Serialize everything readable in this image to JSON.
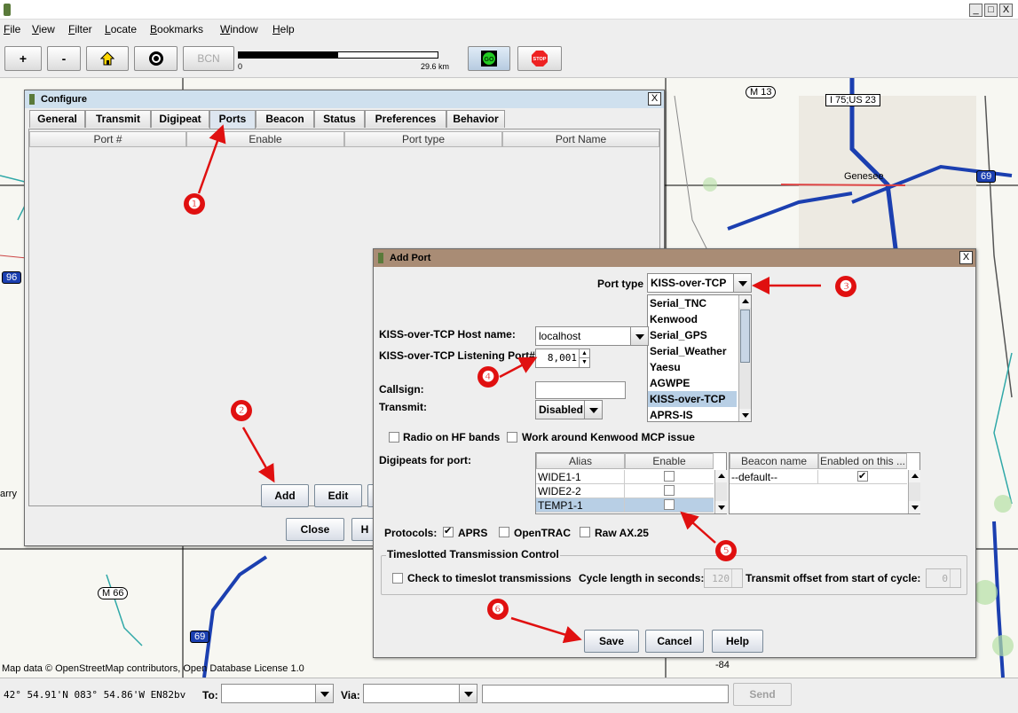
{
  "window": {
    "minimize": "_",
    "maximize": "□",
    "close": "X"
  },
  "menu": [
    {
      "label": "File",
      "u": "F",
      "rest": "ile"
    },
    {
      "label": "View",
      "u": "V",
      "rest": "iew"
    },
    {
      "label": "Filter",
      "u": "F",
      "rest": "ilter"
    },
    {
      "label": "Locate",
      "u": "L",
      "rest": "ocate"
    },
    {
      "label": "Bookmarks",
      "u": "B",
      "rest": "ookmarks"
    },
    {
      "label": "Window",
      "u": "W",
      "rest": "indow"
    },
    {
      "label": "Help",
      "u": "H",
      "rest": "elp"
    }
  ],
  "toolbar": {
    "zoom_in": "+",
    "zoom_out": "-",
    "bcn": "BCN",
    "scale_zero": "0",
    "scale_dist": "29.6 km",
    "scale_fraction": 0.5,
    "go": "GO",
    "stop": "STOP"
  },
  "map": {
    "credit": "Map data © OpenStreetMap contributors, Open Database License 1.0",
    "labels": {
      "m13": "M 13",
      "i75": "I 75;US 23",
      "genesee": "Genesee",
      "i69_east": "69",
      "i96": "96",
      "m66": "M 66",
      "i69_south": "69",
      "harry": "arry",
      "minus84": "-84"
    }
  },
  "configure": {
    "title": "Configure",
    "close": "X",
    "tabs": [
      "General",
      "Transmit",
      "Digipeat",
      "Ports",
      "Beacon",
      "Status",
      "Preferences",
      "Behavior"
    ],
    "active_tab": "Ports",
    "columns": [
      "Port #",
      "Enable",
      "Port type",
      "Port Name"
    ],
    "buttons": {
      "add": "Add",
      "edit": "Edit",
      "close": "Close",
      "help": "H"
    }
  },
  "add_port": {
    "title": "Add Port",
    "close": "X",
    "port_type_label": "Port type",
    "port_type_value": "KISS-over-TCP",
    "port_type_options": [
      "Serial_TNC",
      "Kenwood",
      "Serial_GPS",
      "Serial_Weather",
      "Yaesu",
      "AGWPE",
      "KISS-over-TCP",
      "APRS-IS"
    ],
    "port_type_selected": "KISS-over-TCP",
    "host_label": "KISS-over-TCP Host name:",
    "host_value": "localhost",
    "port_label": "KISS-over-TCP Listening Port#:",
    "port_value": "8,001",
    "callsign_label": "Callsign:",
    "callsign_value": "",
    "transmit_label": "Transmit:",
    "transmit_value": "Disabled",
    "radio_hf": "Radio on HF bands",
    "kenwood_mcp": "Work around Kenwood MCP issue",
    "digipeats_label": "Digipeats for port:",
    "alias_columns": [
      "Alias",
      "Enable"
    ],
    "aliases": [
      {
        "alias": "WIDE1-1",
        "enabled": false
      },
      {
        "alias": "WIDE2-2",
        "enabled": false
      },
      {
        "alias": "TEMP1-1",
        "enabled": false
      }
    ],
    "beacon_columns": [
      "Beacon name",
      "Enabled on this ..."
    ],
    "beacons": [
      {
        "name": "--default--",
        "enabled": true
      }
    ],
    "protocols_label": "Protocols:",
    "protocols": [
      {
        "name": "APRS",
        "checked": true
      },
      {
        "name": "OpenTRAC",
        "checked": false
      },
      {
        "name": "Raw AX.25",
        "checked": false
      }
    ],
    "timeslot_group": "Timeslotted Transmission Control",
    "timeslot_check": "Check to timeslot transmissions",
    "cycle_label": "Cycle length in seconds:",
    "cycle_value": "120",
    "offset_label": "Transmit offset from start of cycle:",
    "offset_value": "0",
    "buttons": {
      "save": "Save",
      "cancel": "Cancel",
      "help": "Help"
    }
  },
  "status": {
    "coords": "42° 54.91'N 083° 54.86'W EN82bv",
    "to_label": "To:",
    "via_label": "Via:",
    "send": "Send"
  },
  "annotations": [
    "❶",
    "❷",
    "❸",
    "❹",
    "❺",
    "❻"
  ],
  "colors": {
    "annotation_red": "#e01010",
    "dialog_title_blue": "#cfe0ee",
    "addport_title_brown": "#a98c75",
    "list_selection": "#b8cfe5",
    "interstate_blue": "#1b3fb0"
  }
}
